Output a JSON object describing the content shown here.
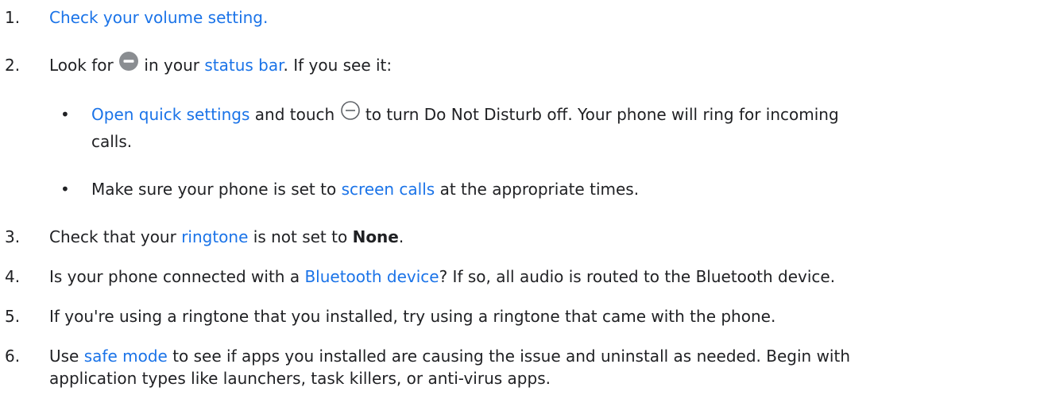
{
  "accent_color": "#1a73e8",
  "text_color": "#202124",
  "items": [
    {
      "number": "1.",
      "link": "Check your volume setting."
    },
    {
      "number": "2.",
      "pre": "Look for",
      "mid": "in your",
      "link": "status bar",
      "post": ". If you see it:",
      "icon": "do-not-disturb-filled-icon",
      "bullets": [
        {
          "link": "Open quick settings",
          "pre": "and touch",
          "icon": "do-not-disturb-outline-icon",
          "post": "to turn Do Not Disturb off. Your phone will ring for incoming",
          "post2": "calls."
        },
        {
          "pre": "Make sure your phone is set to",
          "link": "screen calls",
          "post": "at the appropriate times."
        }
      ]
    },
    {
      "number": "3.",
      "pre": "Check that your",
      "link": "ringtone",
      "mid": "is not set to",
      "bold": "None",
      "post": "."
    },
    {
      "number": "4.",
      "pre": "Is your phone connected with a",
      "link": "Bluetooth device",
      "post": "? If so, all audio is routed to the Bluetooth device."
    },
    {
      "number": "5.",
      "text": "If you're using a ringtone that you installed, try using a ringtone that came with the phone."
    },
    {
      "number": "6.",
      "pre": "Use",
      "link": "safe mode",
      "post": "to see if apps you installed are causing the issue and uninstall as needed. Begin with",
      "post2": "application types like launchers, task killers, or anti-virus apps."
    }
  ]
}
